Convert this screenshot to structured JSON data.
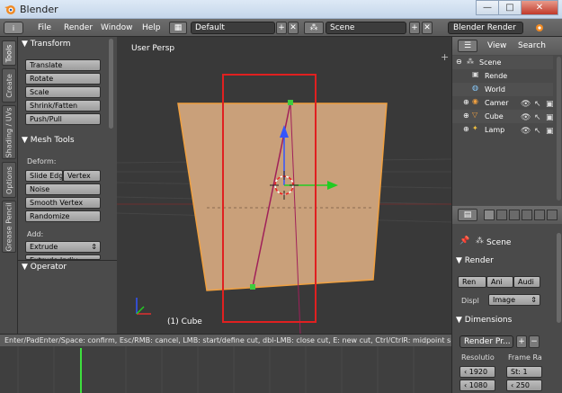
{
  "window": {
    "title": "Blender",
    "controls": {
      "minimize": "—",
      "maximize": "□",
      "close": "✕"
    }
  },
  "info_header": {
    "editor_icon": "i",
    "menus": [
      "File",
      "Render",
      "Window",
      "Help"
    ],
    "screen_layout": "Default",
    "scene": "Scene",
    "render_engine": "Blender Render"
  },
  "tool_tabs": [
    "Tools",
    "Create",
    "Shading / UVs",
    "Options",
    "Grease Pencil"
  ],
  "tool_shelf": {
    "transform": {
      "title": "Transform",
      "buttons": [
        "Translate",
        "Rotate",
        "Scale",
        "Shrink/Fatten",
        "Push/Pull"
      ]
    },
    "mesh_tools": {
      "title": "Mesh Tools",
      "deform_label": "Deform:",
      "slide_edge": "Slide Edg",
      "vertex": "Vertex",
      "buttons": [
        "Noise",
        "Smooth Vertex",
        "Randomize"
      ],
      "add_label": "Add:",
      "extrude": "Extrude",
      "extrude_next": "Extrude Indiv"
    },
    "operator": {
      "title": "Operator"
    }
  },
  "viewport": {
    "view_label": "User Persp",
    "object_label": "(1) Cube"
  },
  "outliner": {
    "view": "View",
    "search": "Search",
    "items": [
      {
        "label": "Scene",
        "icon": "scene-icon"
      },
      {
        "label": "Rende",
        "icon": "render-layers-icon"
      },
      {
        "label": "World",
        "icon": "world-icon"
      },
      {
        "label": "Camer",
        "icon": "camera-icon"
      },
      {
        "label": "Cube",
        "icon": "mesh-icon"
      },
      {
        "label": "Lamp",
        "icon": "lamp-icon"
      }
    ]
  },
  "properties": {
    "context": "Scene",
    "render_panel": "Render",
    "render_buttons": [
      "Ren",
      "Ani",
      "Audi"
    ],
    "display_label": "Displ",
    "display_value": "Image",
    "dimensions_panel": "Dimensions",
    "preset": "Render Pr...",
    "resolution_label": "Resolutio",
    "frame_range_label": "Frame Ra",
    "res_x": "1920",
    "res_y": "1080",
    "start_frame": "St: 1",
    "end_frame": "250"
  },
  "status_text": "Enter/PadEnter/Space: confirm, Esc/RMB: cancel, LMB: start/define cut, dbl-LMB: close cut, E: new cut, Ctrl/CtrlR: midpoint snap",
  "colors": {
    "selection_box": "#e02020",
    "mesh_face": "#c9a07a",
    "mesh_edge": "#f0a040",
    "knife_line": "#a0205a",
    "axis_z": "#3355ff",
    "axis_y": "#22cc22"
  }
}
